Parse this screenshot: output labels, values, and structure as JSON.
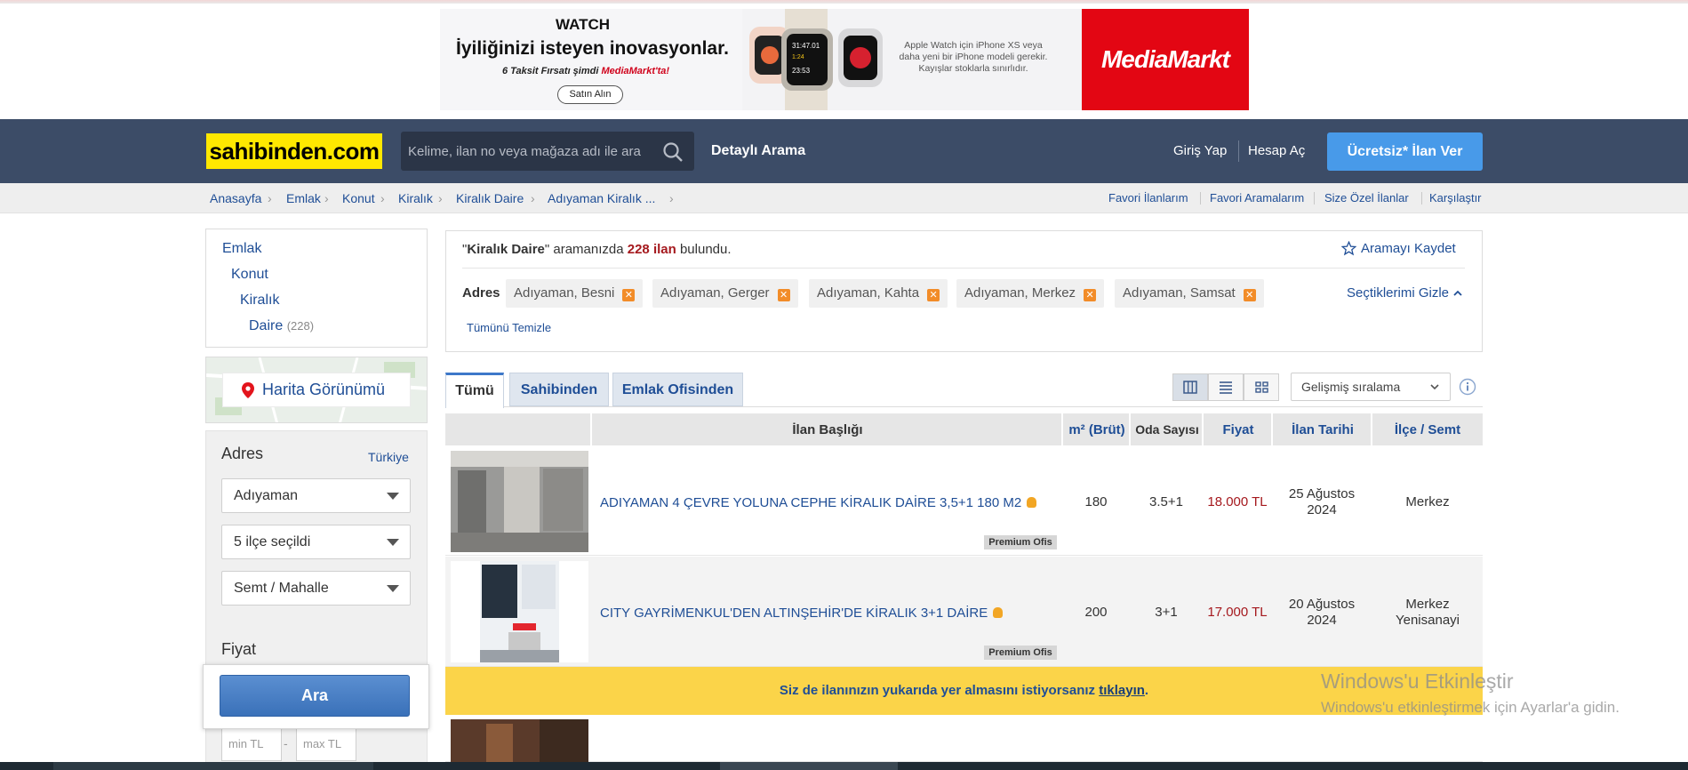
{
  "ad": {
    "brand": "WATCH",
    "headline": "İyiliğinizi isteyen inovasyonlar.",
    "sub_prefix": "6 Taksit Fırsatı şimdi ",
    "sub_brand": "MediaMarkt'ta!",
    "cta": "Satın Alın",
    "fine_print": "Apple Watch için iPhone XS veya daha yeni bir iPhone modeli gerekir. Kayışlar stoklarla sınırlıdır.",
    "retailer": "MediaMarkt"
  },
  "header": {
    "logo": "sahibinden.com",
    "search_placeholder": "Kelime, ilan no veya mağaza adı ile ara",
    "advanced_search": "Detaylı Arama",
    "login": "Giriş Yap",
    "register": "Hesap Aç",
    "post_ad": "Ücretsiz* İlan Ver"
  },
  "breadcrumb": [
    "Anasayfa",
    "Emlak",
    "Konut",
    "Kiralık",
    "Kiralık Daire",
    "Adıyaman Kiralık ..."
  ],
  "top_links": [
    "Favori İlanlarım",
    "Favori Aramalarım",
    "Size Özel İlanlar",
    "Karşılaştır"
  ],
  "sidebar": {
    "categories": [
      {
        "label": "Emlak"
      },
      {
        "label": "Konut"
      },
      {
        "label": "Kiralık"
      },
      {
        "label": "Daire",
        "count": "(228)"
      }
    ],
    "map_view": "Harita Görünümü",
    "address_title": "Adres",
    "country_link": "Türkiye",
    "city_select": "Adıyaman",
    "district_select": "5 ilçe seçildi",
    "neighborhood_select": "Semt / Mahalle",
    "price_title": "Fiyat",
    "search_button": "Ara",
    "min_placeholder": "min TL",
    "max_placeholder": "max TL",
    "dash": "-"
  },
  "results": {
    "query": "Kiralık Daire",
    "text_mid": " aramanızda ",
    "count": "228 ilan",
    "text_end": " bulundu.",
    "save_search": "Aramayı Kaydet",
    "filter_label": "Adres",
    "chips": [
      "Adıyaman, Besni",
      "Adıyaman, Gerger",
      "Adıyaman, Kahta",
      "Adıyaman, Merkez",
      "Adıyaman, Samsat"
    ],
    "hide_selections": "Seçtiklerimi Gizle",
    "clear_all": "Tümünü Temizle"
  },
  "tabs": [
    "Tümü",
    "Sahibinden",
    "Emlak Ofisinden"
  ],
  "sort": "Gelişmiş sıralama",
  "table": {
    "headers": [
      "İlan Başlığı",
      "m² (Brüt)",
      "Oda Sayısı",
      "Fiyat",
      "İlan Tarihi",
      "İlçe / Semt"
    ],
    "rows": [
      {
        "title": "ADIYAMAN 4 ÇEVRE YOLUNA CEPHE KİRALIK DAİRE 3,5+1 180 M2",
        "badge": "Premium Ofis",
        "m2": "180",
        "rooms": "3.5+1",
        "price": "18.000 TL",
        "date_line1": "25 Ağustos",
        "date_line2": "2024",
        "location_line1": "Merkez",
        "location_line2": ""
      },
      {
        "title": "CITY GAYRİMENKUL'DEN ALTINŞEHİR'DE KİRALIK 3+1 DAİRE",
        "badge": "Premium Ofis",
        "m2": "200",
        "rooms": "3+1",
        "price": "17.000 TL",
        "date_line1": "20 Ağustos",
        "date_line2": "2024",
        "location_line1": "Merkez",
        "location_line2": "Yenisanayi"
      }
    ]
  },
  "promo": {
    "text": "Siz de ilanınızın yukarıda yer almasını istiyorsanız ",
    "link": "tıklayın",
    "end": "."
  },
  "watermark": {
    "title": "Windows'u Etkinleştir",
    "subtitle": "Windows'u etkinleştirmek için Ayarlar'a gidin."
  },
  "colors": {
    "header_bg": "#3c4c67",
    "logo_bg": "#ffe800",
    "link": "#1f4e96",
    "price": "#a5191e",
    "post_ad_bg": "#489ae9",
    "promo_bg": "#fbd449"
  }
}
